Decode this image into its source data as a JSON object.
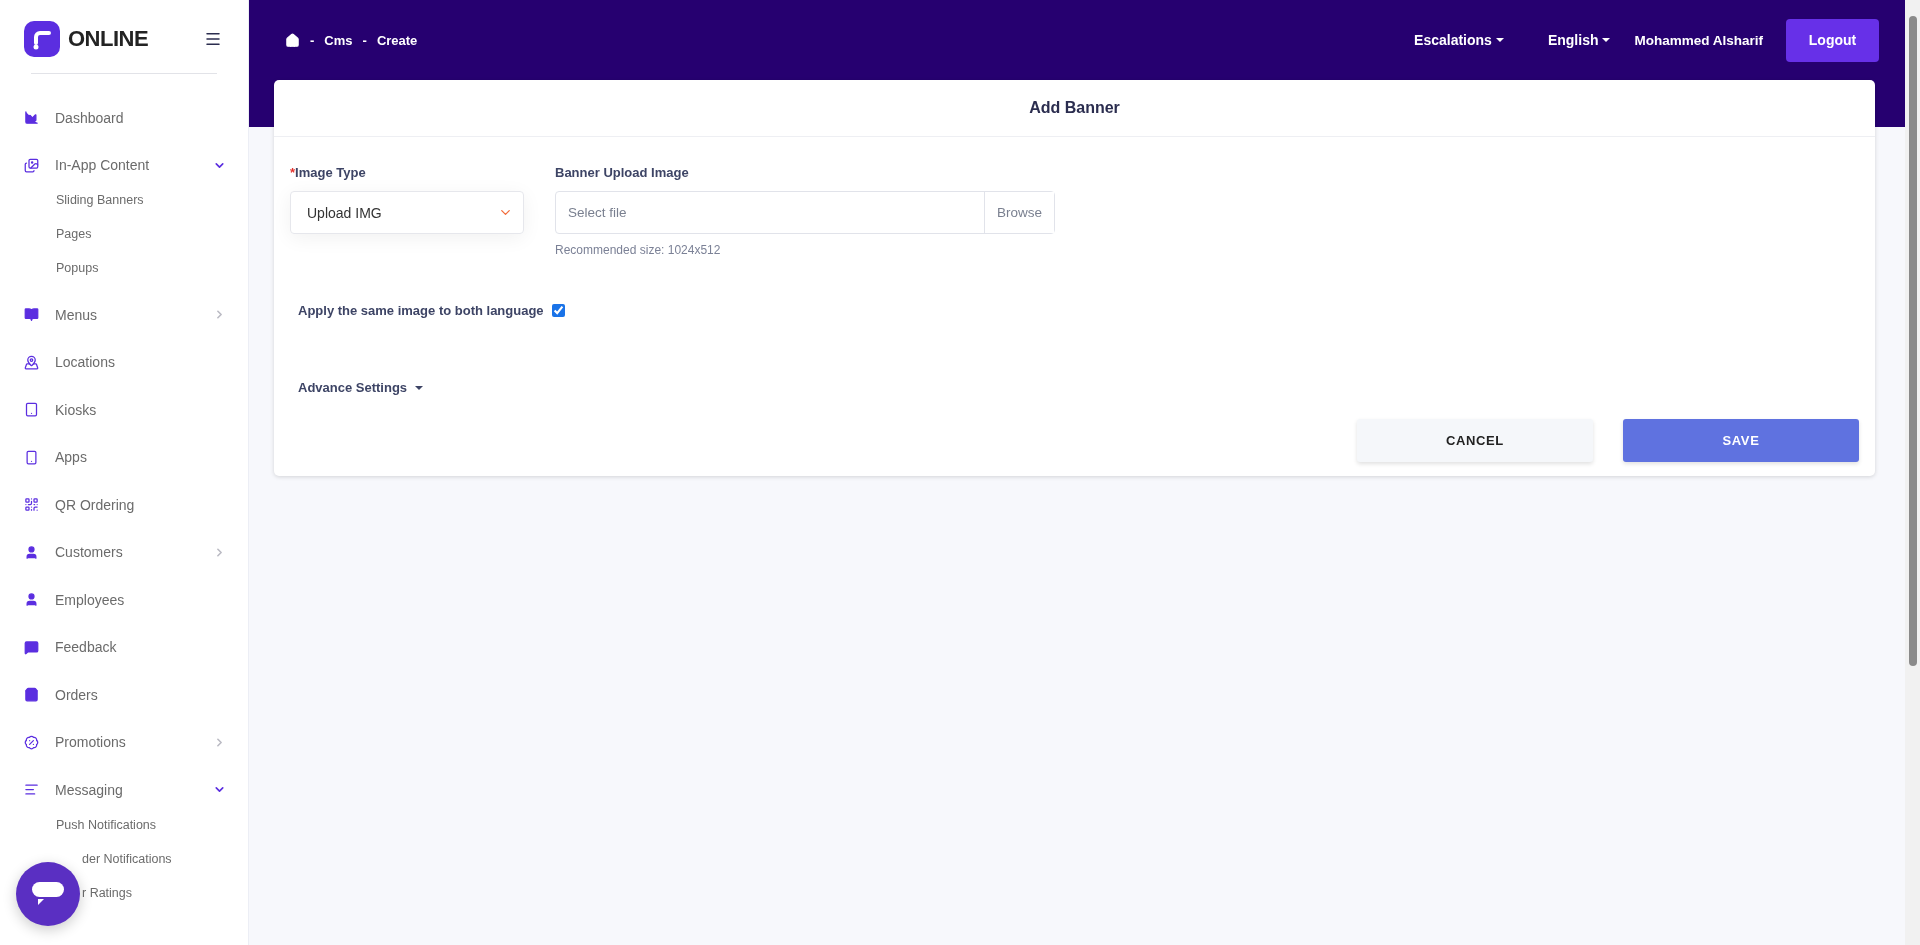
{
  "logo": {
    "text": "ONLINE"
  },
  "sidebar": {
    "items": [
      {
        "label": "Dashboard"
      },
      {
        "label": "In-App Content",
        "expanded": true,
        "children": [
          {
            "label": "Sliding Banners",
            "covered": false
          },
          {
            "label": "Pages",
            "covered": false
          },
          {
            "label": "Popups",
            "covered": false
          }
        ]
      },
      {
        "label": "Menus",
        "expanded": false
      },
      {
        "label": "Locations"
      },
      {
        "label": "Kiosks"
      },
      {
        "label": "Apps"
      },
      {
        "label": "QR Ordering"
      },
      {
        "label": "Customers",
        "expanded": false
      },
      {
        "label": "Employees"
      },
      {
        "label": "Feedback"
      },
      {
        "label": "Orders"
      },
      {
        "label": "Promotions",
        "expanded": false
      },
      {
        "label": "Messaging",
        "expanded": true,
        "children": [
          {
            "label": "Push Notifications",
            "covered": false
          },
          {
            "label": "der Notifications",
            "covered": true
          },
          {
            "label": "r Ratings",
            "covered": true
          }
        ]
      }
    ]
  },
  "breadcrumb": [
    "-",
    "Cms",
    "-",
    "Create"
  ],
  "topbar": {
    "menus": [
      "Escalations",
      "English"
    ],
    "user": "Mohammed Alsharif",
    "logout": "Logout"
  },
  "card": {
    "title": "Add Banner",
    "image_type": {
      "required_mark": "*",
      "label": "Image Type",
      "value": "Upload IMG"
    },
    "upload": {
      "label": "Banner Upload Image",
      "placeholder": "Select file",
      "browse": "Browse",
      "hint": "Recommended size: 1024x512"
    },
    "same_image": {
      "label": "Apply the same image to both language",
      "checked": true
    },
    "advance": {
      "label": "Advance Settings",
      "expanded": false
    },
    "buttons": {
      "cancel": "CANCEL",
      "save": "SAVE"
    }
  }
}
